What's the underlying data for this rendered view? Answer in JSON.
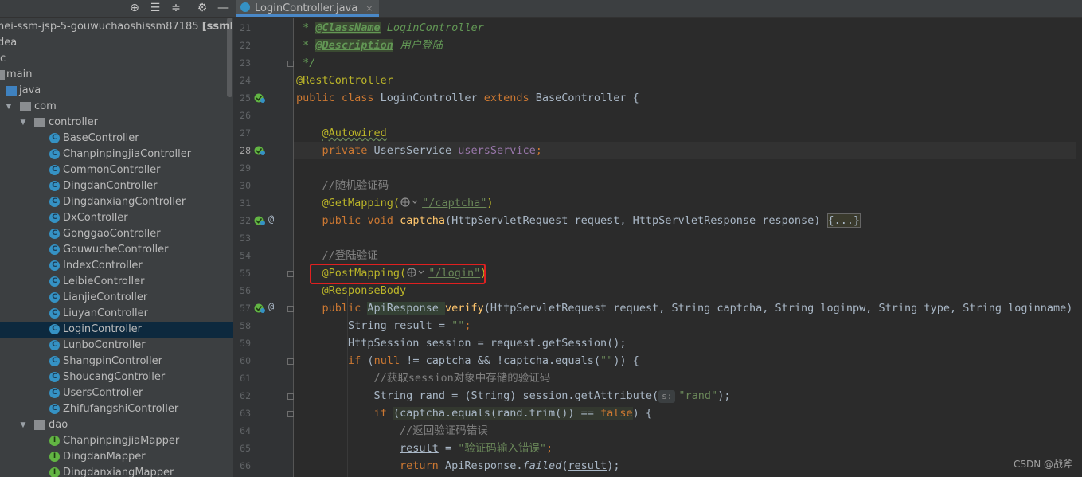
{
  "project": {
    "root_label": "hei-ssm-jsp-5-gouwuchaoshissm87185",
    "root_suffix": "[ssmliangh",
    "items": [
      {
        "label": "dea",
        "kind": "plain"
      },
      {
        "label": "c",
        "kind": "plain"
      },
      {
        "label": "main",
        "kind": "folder"
      },
      {
        "label": "java",
        "kind": "folder"
      },
      {
        "label": "com",
        "kind": "folder"
      },
      {
        "label": "controller",
        "kind": "folder"
      },
      {
        "label": "BaseController",
        "kind": "class"
      },
      {
        "label": "ChanpinpingjiaController",
        "kind": "class"
      },
      {
        "label": "CommonController",
        "kind": "class"
      },
      {
        "label": "DingdanController",
        "kind": "class"
      },
      {
        "label": "DingdanxiangController",
        "kind": "class"
      },
      {
        "label": "DxController",
        "kind": "class"
      },
      {
        "label": "GonggaoController",
        "kind": "class"
      },
      {
        "label": "GouwucheController",
        "kind": "class"
      },
      {
        "label": "IndexController",
        "kind": "class"
      },
      {
        "label": "LeibieController",
        "kind": "class"
      },
      {
        "label": "LianjieController",
        "kind": "class"
      },
      {
        "label": "LiuyanController",
        "kind": "class"
      },
      {
        "label": "LoginController",
        "kind": "class"
      },
      {
        "label": "LunboController",
        "kind": "class"
      },
      {
        "label": "ShangpinController",
        "kind": "class"
      },
      {
        "label": "ShoucangController",
        "kind": "class"
      },
      {
        "label": "UsersController",
        "kind": "class"
      },
      {
        "label": "ZhifufangshiController",
        "kind": "class"
      },
      {
        "label": "dao",
        "kind": "folder"
      },
      {
        "label": "ChanpinpingjiaMapper",
        "kind": "interface"
      },
      {
        "label": "DingdanMapper",
        "kind": "interface"
      },
      {
        "label": "DingdanxiangMapper",
        "kind": "interface"
      }
    ]
  },
  "toolbar": {
    "icons": [
      "target-icon",
      "expand-all-icon",
      "collapse-all-icon",
      "gear-icon",
      "minimize-icon"
    ],
    "glyphs": [
      "⊕",
      "☰",
      "≑",
      "⚙",
      "—"
    ]
  },
  "editor": {
    "tab_label": "LoginController.java",
    "tab_close": "×",
    "line_numbers": [
      "21",
      "22",
      "23",
      "24",
      "25",
      "26",
      "27",
      "28",
      "29",
      "30",
      "31",
      "32",
      "53",
      "54",
      "55",
      "56",
      "57",
      "58",
      "59",
      "60",
      "61",
      "62",
      "63",
      "64",
      "65",
      "66"
    ],
    "code": {
      "l21_a": " * ",
      "l21_tag": "@ClassName",
      "l21_b": " LoginController",
      "l22_a": " * ",
      "l22_tag": "@Description",
      "l22_b": " 用户登陆",
      "l23": " */",
      "l24": "@RestController",
      "l25_kw1": "public class ",
      "l25_name": "LoginController ",
      "l25_kw2": "extends ",
      "l25_rest": "BaseController {",
      "l27": "@Autowired",
      "l28_kw": "private ",
      "l28_type": "UsersService ",
      "l28_field": "usersService",
      "l28_semi": ";",
      "l30": "//随机验证码",
      "l31_ann": "@GetMapping(",
      "l31_url": "\"/captcha\"",
      "l31_end": ")",
      "l32_kw": "public void ",
      "l32_fn": "captcha",
      "l32_rest": "(HttpServletRequest request, HttpServletResponse response) ",
      "l32_fold": "{...}",
      "l54": "//登陆验证",
      "l55_ann": "@PostMapping(",
      "l55_url": "\"/login\"",
      "l55_end": ")",
      "l56": "@ResponseBody",
      "l57_kw": "public ",
      "l57_type": "ApiResponse ",
      "l57_fn": "verify",
      "l57_rest": "(HttpServletRequest request, String captcha, String loginpw, String type, String loginname) {",
      "l58_a": "String ",
      "l58_var": "result",
      "l58_b": " = ",
      "l58_str": "\"\"",
      "l58_c": ";",
      "l59": "HttpSession session = request.getSession();",
      "l60_kw": "if ",
      "l60_a": "(",
      "l60_null": "null",
      "l60_b": " != captcha && !captcha.equals(",
      "l60_str": "\"\"",
      "l60_c": ")) {",
      "l61": "//获取session对象中存储的验证码",
      "l62_a": "String rand = (String) session.getAttribute(",
      "l62_hint": "s:",
      "l62_str": "\"rand\"",
      "l62_b": ");",
      "l63_kw": "if ",
      "l63_a": "(captcha.equals(rand.trim()) == ",
      "l63_false": "false",
      "l63_b": ") {",
      "l64": "//返回验证码错误",
      "l65_var": "result",
      "l65_a": " = ",
      "l65_str": "\"验证码输入错误\"",
      "l65_b": ";",
      "l66_kw": "return ",
      "l66_a": "ApiResponse.",
      "l66_fn": "failed",
      "l66_b": "(",
      "l66_var": "result",
      "l66_c": ");"
    }
  },
  "watermark": "CSDN @战斧",
  "colors": {
    "highlight_box": "#e02020",
    "selection": "#0d293e"
  }
}
